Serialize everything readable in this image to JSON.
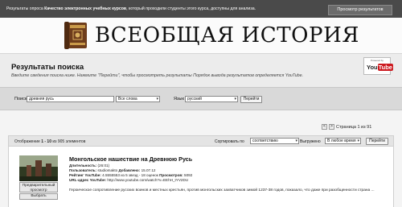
{
  "topbar": {
    "message_pre": "Результаты опроса ",
    "message_bold": "Качество электронных учебных курсов",
    "message_post": ", который проходили студенты этого курса, доступны для анализа.",
    "results_button": "Просмотр результатов"
  },
  "banner": {
    "title": "ВСЕОБЩАЯ ИСТОРИЯ",
    "icon": "book-icon"
  },
  "results_header": {
    "title": "Результаты поиска",
    "subtitle": "Введите сведения поиска ниже. Нажмите \"Перейти\", чтобы просмотреть результаты Порядок вывода результатов определяется YouTube.",
    "badge_powered": "Powered by",
    "badge_you": "You",
    "badge_tube": "Tube"
  },
  "search": {
    "label": "Поиск",
    "query": "древняя русь",
    "mode": "Все слова",
    "language_label": "Язык",
    "language": "русский",
    "go_button": "Перейти"
  },
  "pager": {
    "prev": "<",
    "next": ">",
    "label": "Страница 1 из 91"
  },
  "toolbar": {
    "shown_pre": "Отображение ",
    "shown_range": "1 - 10",
    "shown_post": " из 905 элементов",
    "sort_label": "Сортировать по",
    "sort_value": "соответствию",
    "uploaded_label": "Выгружено",
    "uploaded_value": "В любое время",
    "go_button": "Перейти"
  },
  "results": [
    {
      "title": "Монгольское нашествие на Древнюю Русь",
      "duration_label": "Длительность:",
      "duration": "(26:01)",
      "user_label": "Пользователь:",
      "user": "studiomakto",
      "added_label": "Добавлено:",
      "added": "15.07.12",
      "rating_label": "Рейтинг YouTube:",
      "rating": "4.5555553 из 5 звезд - 18 оценок",
      "views_label": "Просмотров:",
      "views": "5092",
      "url_label": "URL-адрес YouTube:",
      "url": "http://www.youtube.com/watch?v=EEhH_tYV2DU",
      "description": "Героическое сопротивление русских воинов и местных крестьян, против монгольских захватчиков зимой 1237-38 годов, показало, что даже при разобщенности страна ...",
      "preview_button": "Предварительный просмотр",
      "choose_button": "Выбрать"
    }
  ]
}
